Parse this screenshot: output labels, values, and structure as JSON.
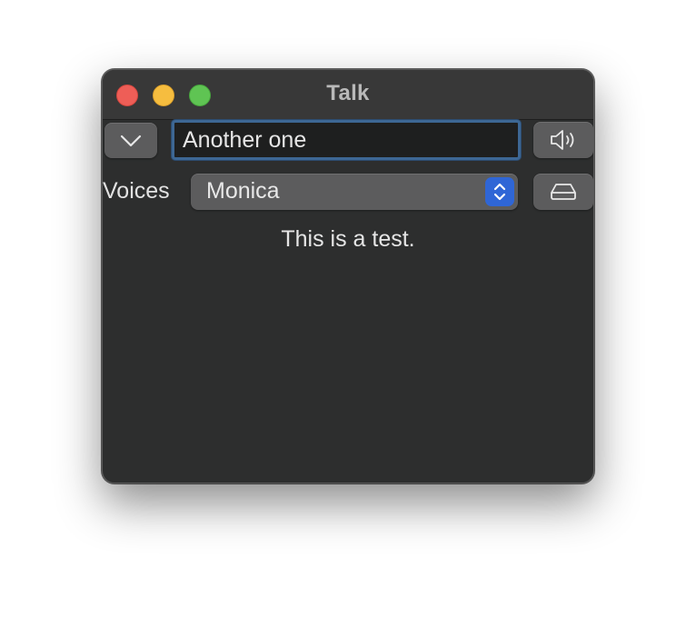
{
  "window": {
    "title": "Talk"
  },
  "toolbar": {
    "expand_icon": "chevron-down-icon",
    "text_input": {
      "value": "Another one"
    },
    "speak_icon": "speaker-icon"
  },
  "voices": {
    "label": "Voices",
    "selected": "Monica",
    "stepper_icon": "up-down-chevrons-icon",
    "save_icon": "drive-icon"
  },
  "message": "This is a test.",
  "colors": {
    "window_bg": "#2d2e2e",
    "titlebar_bg": "#383838",
    "button_bg": "#5c5c5d",
    "focus_ring": "#3d6794",
    "accent": "#2f66d6",
    "close": "#ee5e57",
    "minimize": "#f6bd3f",
    "maximize": "#5fc453"
  }
}
